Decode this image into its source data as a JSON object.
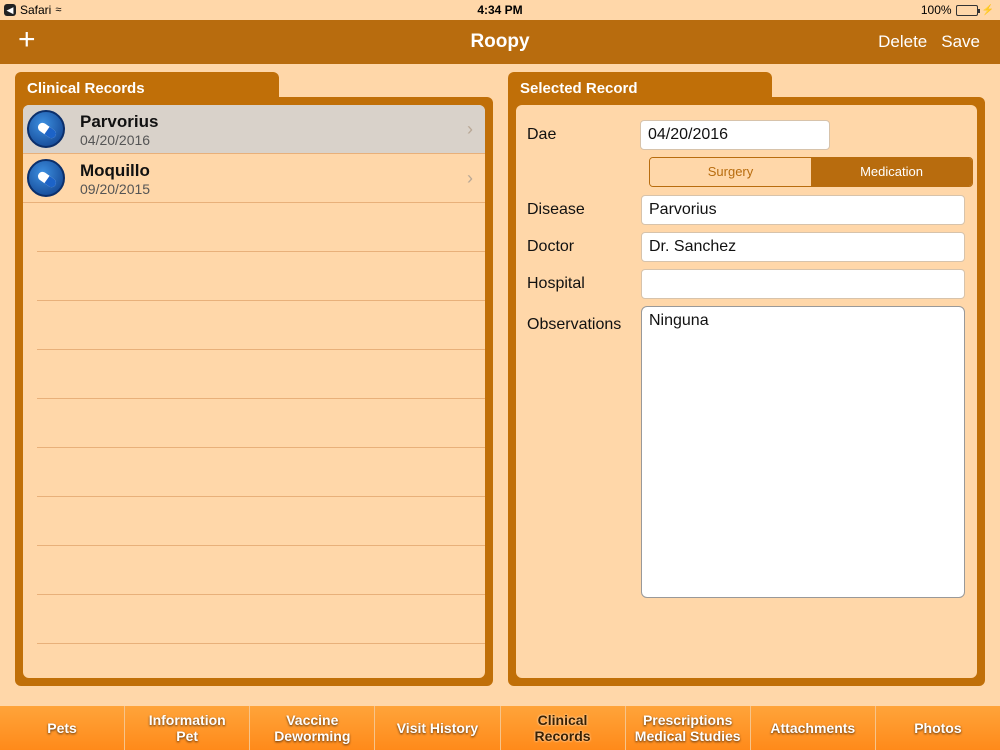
{
  "status_bar": {
    "back_app": "Safari",
    "time": "4:34 PM",
    "battery": "100%"
  },
  "navbar": {
    "add_label": "+",
    "title": "Roopy",
    "delete_label": "Delete",
    "save_label": "Save"
  },
  "records_panel": {
    "title": "Clinical Records",
    "items": [
      {
        "name": "Parvorius",
        "date": "04/20/2016",
        "selected": true
      },
      {
        "name": "Moquillo",
        "date": "09/20/2015",
        "selected": false
      }
    ]
  },
  "selected_panel": {
    "title": "Selected Record",
    "date_label": "Dae",
    "date_value": "04/20/2016",
    "segments": [
      {
        "label": "Surgery",
        "active": false
      },
      {
        "label": "Medication",
        "active": true
      }
    ],
    "disease_label": "Disease",
    "disease_value": "Parvorius",
    "doctor_label": "Doctor",
    "doctor_value": "Dr. Sanchez",
    "hospital_label": "Hospital",
    "hospital_value": "",
    "observations_label": "Observations",
    "observations_value": "Ninguna"
  },
  "tabbar": {
    "tabs": [
      {
        "line1": "Pets",
        "line2": ""
      },
      {
        "line1": "Information",
        "line2": "Pet"
      },
      {
        "line1": "Vaccine",
        "line2": "Deworming"
      },
      {
        "line1": "Visit History",
        "line2": ""
      },
      {
        "line1": "Clinical",
        "line2": "Records"
      },
      {
        "line1": "Prescriptions",
        "line2": "Medical Studies"
      },
      {
        "line1": "Attachments",
        "line2": ""
      },
      {
        "line1": "Photos",
        "line2": ""
      }
    ]
  },
  "colors": {
    "accent": "#b86c0e",
    "background": "#ffd7a9",
    "tabbar": "#ff8a1a"
  }
}
